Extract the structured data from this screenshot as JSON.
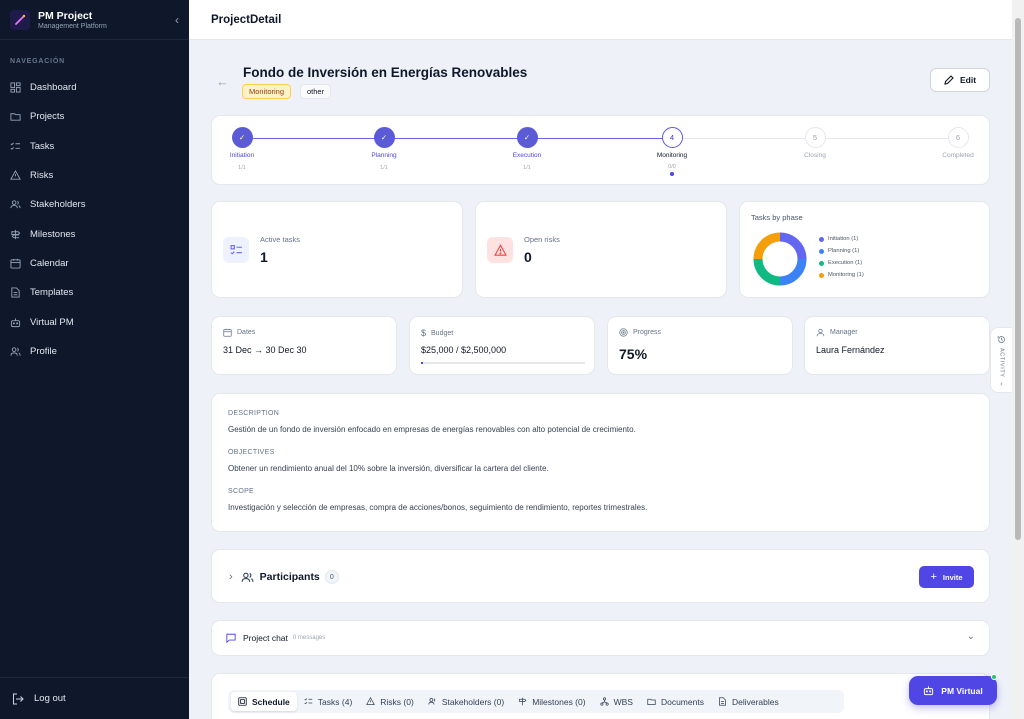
{
  "app": {
    "title": "PM Project",
    "subtitle": "Management Platform"
  },
  "sidebar": {
    "section": "NAVEGACIÓN",
    "items": [
      {
        "label": "Dashboard",
        "icon": "dashboard-icon"
      },
      {
        "label": "Projects",
        "icon": "folder-icon"
      },
      {
        "label": "Tasks",
        "icon": "list-check-icon"
      },
      {
        "label": "Risks",
        "icon": "warning-icon"
      },
      {
        "label": "Stakeholders",
        "icon": "users-icon"
      },
      {
        "label": "Milestones",
        "icon": "signpost-icon"
      },
      {
        "label": "Calendar",
        "icon": "calendar-icon"
      },
      {
        "label": "Templates",
        "icon": "document-icon"
      },
      {
        "label": "Virtual PM",
        "icon": "bot-icon"
      },
      {
        "label": "Profile",
        "icon": "profile-icon"
      }
    ],
    "logout": "Log out"
  },
  "header": {
    "title": "ProjectDetail"
  },
  "project": {
    "name": "Fondo de Inversión en Energías Renovables",
    "status_badge": "Monitoring",
    "type_badge": "other",
    "edit_label": "Edit"
  },
  "phases": [
    {
      "num": "1",
      "label": "Initiation",
      "count": "1/1",
      "state": "done"
    },
    {
      "num": "2",
      "label": "Planning",
      "count": "1/1",
      "state": "done"
    },
    {
      "num": "3",
      "label": "Execution",
      "count": "1/1",
      "state": "done"
    },
    {
      "num": "4",
      "label": "Monitoring",
      "count": "0/0",
      "state": "active"
    },
    {
      "num": "5",
      "label": "Closing",
      "count": "",
      "state": "pending"
    },
    {
      "num": "6",
      "label": "Completed",
      "count": "",
      "state": "pending"
    }
  ],
  "metrics": {
    "active_tasks": {
      "label": "Active tasks",
      "value": "1"
    },
    "open_risks": {
      "label": "Open risks",
      "value": "0"
    }
  },
  "tasks_by_phase": {
    "title": "Tasks by phase",
    "items": [
      {
        "label": "Initiation (1)",
        "value": 1,
        "color": "#6366f1"
      },
      {
        "label": "Planning (1)",
        "value": 1,
        "color": "#3b82f6"
      },
      {
        "label": "Execution (1)",
        "value": 1,
        "color": "#10b981"
      },
      {
        "label": "Monitoring (1)",
        "value": 1,
        "color": "#f59e0b"
      }
    ]
  },
  "stats": {
    "dates": {
      "label": "Dates",
      "value": "31 Dec → 30 Dec 30"
    },
    "budget": {
      "label": "Budget",
      "value": "$25,000 / $2,500,000",
      "spent_fraction": 0.01
    },
    "progress": {
      "label": "Progress",
      "value": "75%"
    },
    "manager": {
      "label": "Manager",
      "value": "Laura Fernández"
    }
  },
  "details": {
    "description_h": "DESCRIPTION",
    "description": "Gestión de un fondo de inversión enfocado en empresas de energías renovables con alto potencial de crecimiento.",
    "objectives_h": "OBJECTIVES",
    "objectives": "Obtener un rendimiento anual del 10% sobre la inversión, diversificar la cartera del cliente.",
    "scope_h": "SCOPE",
    "scope": "Investigación y selección de empresas, compra de acciones/bonos, seguimiento de rendimiento, reportes trimestrales."
  },
  "participants": {
    "title": "Participants",
    "count": "0",
    "invite": "Invite"
  },
  "chat": {
    "title": "Project chat",
    "count": "0 messages"
  },
  "tabs": [
    {
      "label": "Schedule",
      "icon": "schedule-icon"
    },
    {
      "label": "Tasks (4)",
      "icon": "tasks-icon"
    },
    {
      "label": "Risks (0)",
      "icon": "risk-icon"
    },
    {
      "label": "Stakeholders (0)",
      "icon": "stakeholders-icon"
    },
    {
      "label": "Milestones (0)",
      "icon": "milestones-icon"
    },
    {
      "label": "WBS",
      "icon": "wbs-icon"
    },
    {
      "label": "Documents",
      "icon": "documents-icon"
    },
    {
      "label": "Deliverables",
      "icon": "deliverables-icon"
    }
  ],
  "activity_tab": "ACTIVITY",
  "pm_virtual": "PM Virtual"
}
